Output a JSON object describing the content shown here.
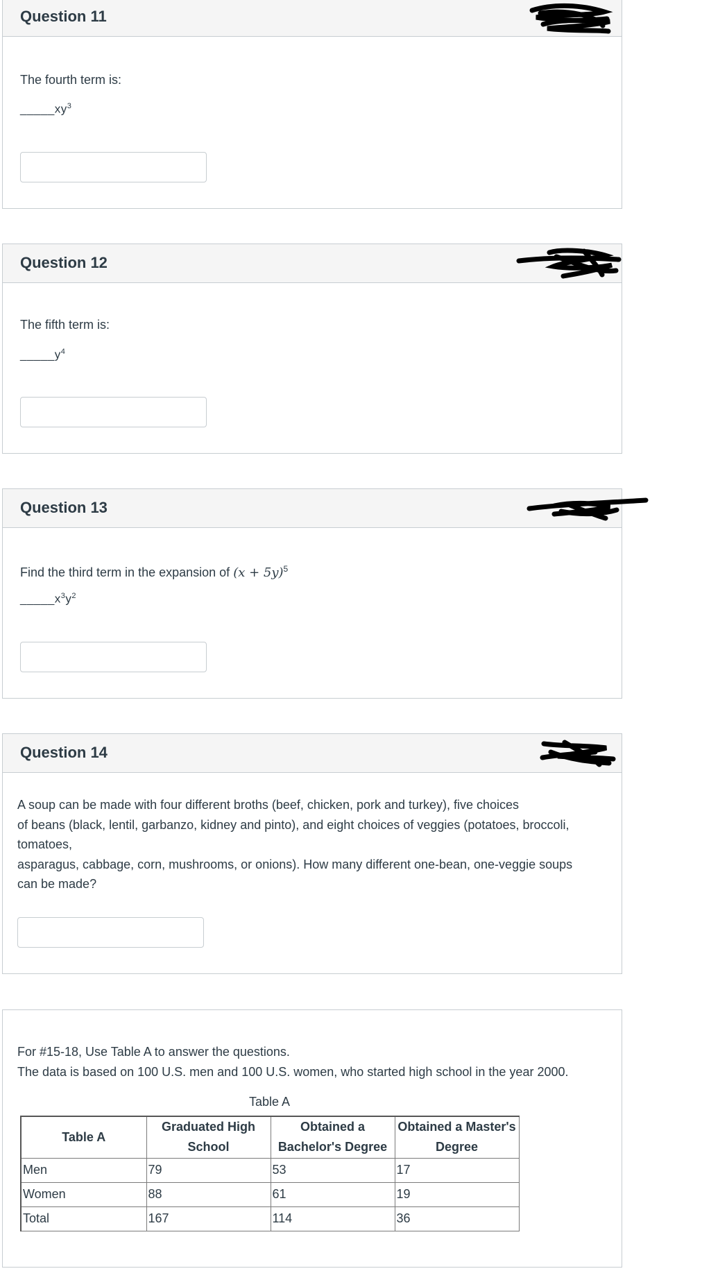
{
  "q11": {
    "title": "Question 11",
    "prompt": "The fourth term is:",
    "blank": "_____",
    "term": "xy",
    "exp": "3"
  },
  "q12": {
    "title": "Question 12",
    "prompt": "The fifth term is:",
    "blank": "_____",
    "term": "y",
    "exp": "4"
  },
  "q13": {
    "title": "Question 13",
    "prompt": "Find the third term in the expansion of",
    "expr": "(x + 5y)",
    "expr_exp": "5",
    "blank": "_____",
    "term_a": "x",
    "exp_a": "3",
    "term_b": "y",
    "exp_b": "2"
  },
  "q14": {
    "title": "Question 14",
    "lines": [
      "A soup can be made with four different broths (beef, chicken, pork and turkey), five choices",
      "of beans (black, lentil, garbanzo, kidney and pinto), and eight choices of veggies (potatoes, broccoli,",
      "tomatoes,",
      "asparagus, cabbage, corn, mushrooms, or onions). How many different one-bean, one-veggie soups",
      "can be made?"
    ]
  },
  "q15": {
    "intro_1": "For #15-18, Use Table A to answer the questions.",
    "intro_2": "The data is based on 100 U.S. men and 100 U.S. women, who started high school in the year 2000.",
    "caption": "Table A",
    "table": {
      "corner": "Table A",
      "headers": [
        "Graduated High School",
        "Obtained a Bachelor's Degree",
        "Obtained a Master's Degree"
      ],
      "rows": [
        {
          "label": "Men",
          "values": [
            "79",
            "53",
            "17"
          ]
        },
        {
          "label": "Women",
          "values": [
            "88",
            "61",
            "19"
          ]
        },
        {
          "label": "Total",
          "values": [
            "167",
            "114",
            "36"
          ]
        }
      ]
    }
  }
}
